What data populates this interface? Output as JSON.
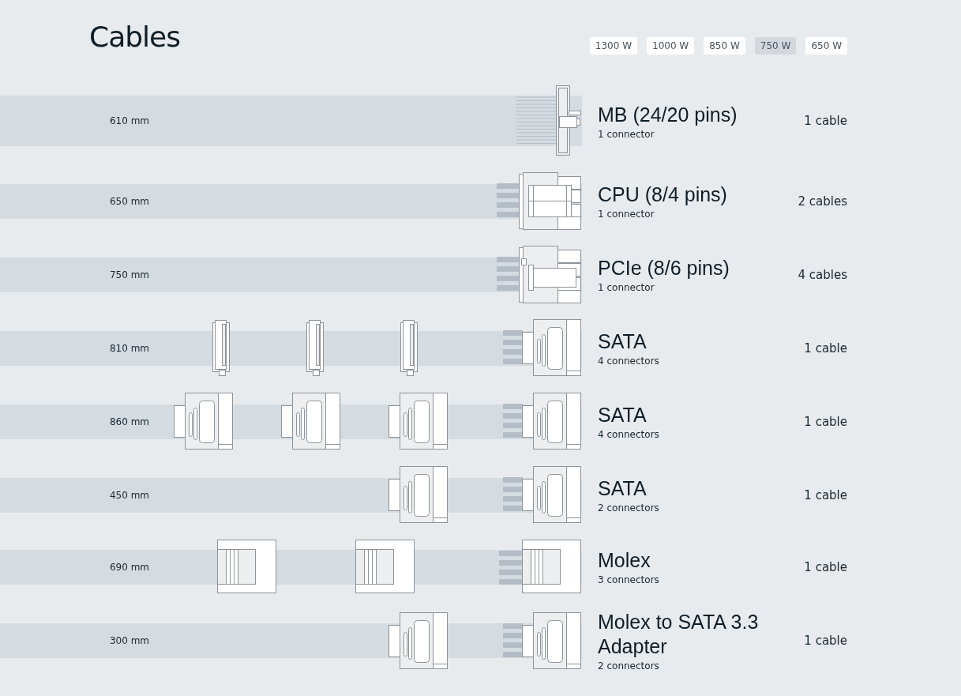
{
  "title": "Cables",
  "tabs": [
    {
      "label": "1300 W",
      "selected": false
    },
    {
      "label": "1000 W",
      "selected": false
    },
    {
      "label": "850 W",
      "selected": false
    },
    {
      "label": "750 W",
      "selected": true
    },
    {
      "label": "650 W",
      "selected": false
    }
  ],
  "cables": [
    {
      "length": "610 mm",
      "name": "MB (24/20 pins)",
      "connectors": "1 connector",
      "count": "1 cable",
      "end_plug": {
        "kind": "mb"
      }
    },
    {
      "length": "650 mm",
      "name": "CPU (8/4 pins)",
      "connectors": "1 connector",
      "count": "2 cables",
      "end_plug": {
        "kind": "cpu"
      }
    },
    {
      "length": "750 mm",
      "name": "PCIe (8/6 pins)",
      "connectors": "1 connector",
      "count": "4 cables",
      "end_plug": {
        "kind": "pcie"
      }
    },
    {
      "length": "810 mm",
      "name": "SATA",
      "connectors": "4 connectors",
      "count": "1 cable",
      "end_plug": {
        "kind": "sata"
      },
      "inline_plugs": [
        {
          "kind": "sata-edge"
        },
        {
          "kind": "sata-edge"
        },
        {
          "kind": "sata-edge"
        }
      ]
    },
    {
      "length": "860 mm",
      "name": "SATA",
      "connectors": "4 connectors",
      "count": "1 cable",
      "end_plug": {
        "kind": "sata"
      },
      "inline_plugs": [
        {
          "kind": "sata"
        },
        {
          "kind": "sata"
        },
        {
          "kind": "sata"
        }
      ]
    },
    {
      "length": "450 mm",
      "name": "SATA",
      "connectors": "2 connectors",
      "count": "1 cable",
      "end_plug": {
        "kind": "sata"
      },
      "inline_plugs": [
        {
          "kind": "sata"
        }
      ]
    },
    {
      "length": "690 mm",
      "name": "Molex",
      "connectors": "3 connectors",
      "count": "1 cable",
      "end_plug": {
        "kind": "molex"
      },
      "inline_plugs": [
        {
          "kind": "molex"
        },
        {
          "kind": "molex"
        }
      ]
    },
    {
      "length": "300 mm",
      "name": "Molex to SATA 3.3 Adapter",
      "connectors": "2 connectors",
      "count": "1 cable",
      "end_plug": {
        "kind": "sata"
      },
      "inline_plugs": [
        {
          "kind": "sata"
        }
      ]
    }
  ]
}
